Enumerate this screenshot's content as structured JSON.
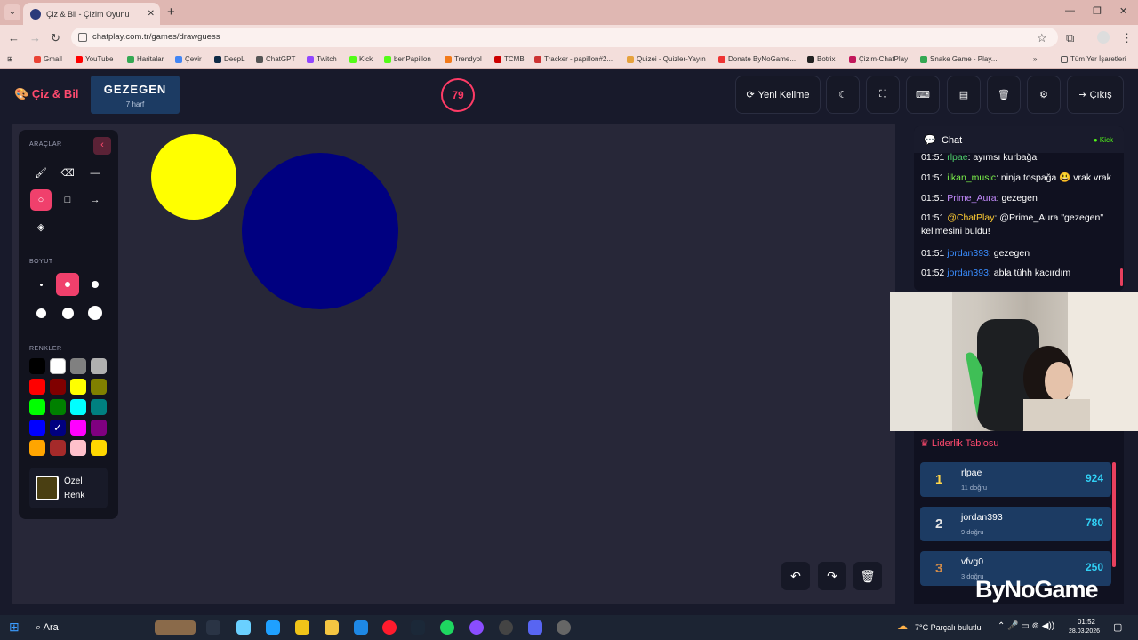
{
  "browser": {
    "tab_title": "Çiz & Bil - Çizim Oyunu",
    "url": "chatplay.com.tr/games/drawguess",
    "bookmarks": [
      "Gmail",
      "YouTube",
      "Haritalar",
      "Çevir",
      "DeepL",
      "ChatGPT",
      "Twitch",
      "Kick",
      "benPapillon",
      "Trendyol",
      "TCMB",
      "Tracker - papillon#2...",
      "Quizei - Quizler-Yayın",
      "Donate ByNoGame...",
      "Botrix",
      "Çizim-ChatPlay",
      "Snake Game - Play..."
    ],
    "all_bookmarks": "Tüm Yer İşaretleri"
  },
  "header": {
    "logo": "Çiz & Bil",
    "word": "GEZEGEN",
    "word_len": "7 harf",
    "timer": "79",
    "new_word": "Yeni Kelime",
    "exit": "Çıkış"
  },
  "tools": {
    "title": "ARAÇLAR",
    "size_title": "BOYUT",
    "colors_title": "RENKLER",
    "custom_label_1": "Özel",
    "custom_label_2": "Renk",
    "custom_color": "#4a3f12",
    "palette": [
      "#000000",
      "#ffffff",
      "#808080",
      "#b0b0b0",
      "#ff0000",
      "#800000",
      "#ffff00",
      "#808000",
      "#00ff00",
      "#008000",
      "#00ffff",
      "#008080",
      "#0000ff",
      "#000080",
      "#ff00ff",
      "#800080",
      "#ffa500",
      "#a52a2a",
      "#ffc0cb",
      "#ffd700"
    ]
  },
  "chat": {
    "title": "Chat",
    "platform": "Kick",
    "messages": [
      {
        "time": "01:51",
        "user": "rlpae",
        "color": "#4fd06b",
        "text": ": ayımsı kurbağa"
      },
      {
        "time": "01:51",
        "user": "ilkan_music",
        "color": "#7cf24a",
        "text": ": ninja tospağa 😃 vrak vrak"
      },
      {
        "time": "01:51",
        "user": "Prime_Aura",
        "color": "#c58bff",
        "text": ": gezegen"
      },
      {
        "time": "01:51",
        "user": "@ChatPlay",
        "color": "#ffcc33",
        "text": ": @Prime_Aura \"gezegen\" kelimesini buldu!"
      },
      {
        "time": "01:51",
        "user": "jordan393",
        "color": "#3a8dff",
        "text": ": gezegen"
      },
      {
        "time": "01:52",
        "user": "jordan393",
        "color": "#3a8dff",
        "text": ": abla tühh kacırdım"
      }
    ]
  },
  "leaderboard": {
    "title": "Liderlik Tablosu",
    "rows": [
      {
        "rank": "1",
        "name": "rlpae",
        "sub": "11 doğru",
        "score": "924"
      },
      {
        "rank": "2",
        "name": "jordan393",
        "sub": "9 doğru",
        "score": "780"
      },
      {
        "rank": "3",
        "name": "vfvg0",
        "sub": "3 doğru",
        "score": "250"
      }
    ]
  },
  "overlay_brand": "ByNoGame",
  "taskbar": {
    "search": "Ara",
    "weather": "7°C  Parçalı bulutlu",
    "time": "01:52",
    "date": "28.03.2026"
  }
}
